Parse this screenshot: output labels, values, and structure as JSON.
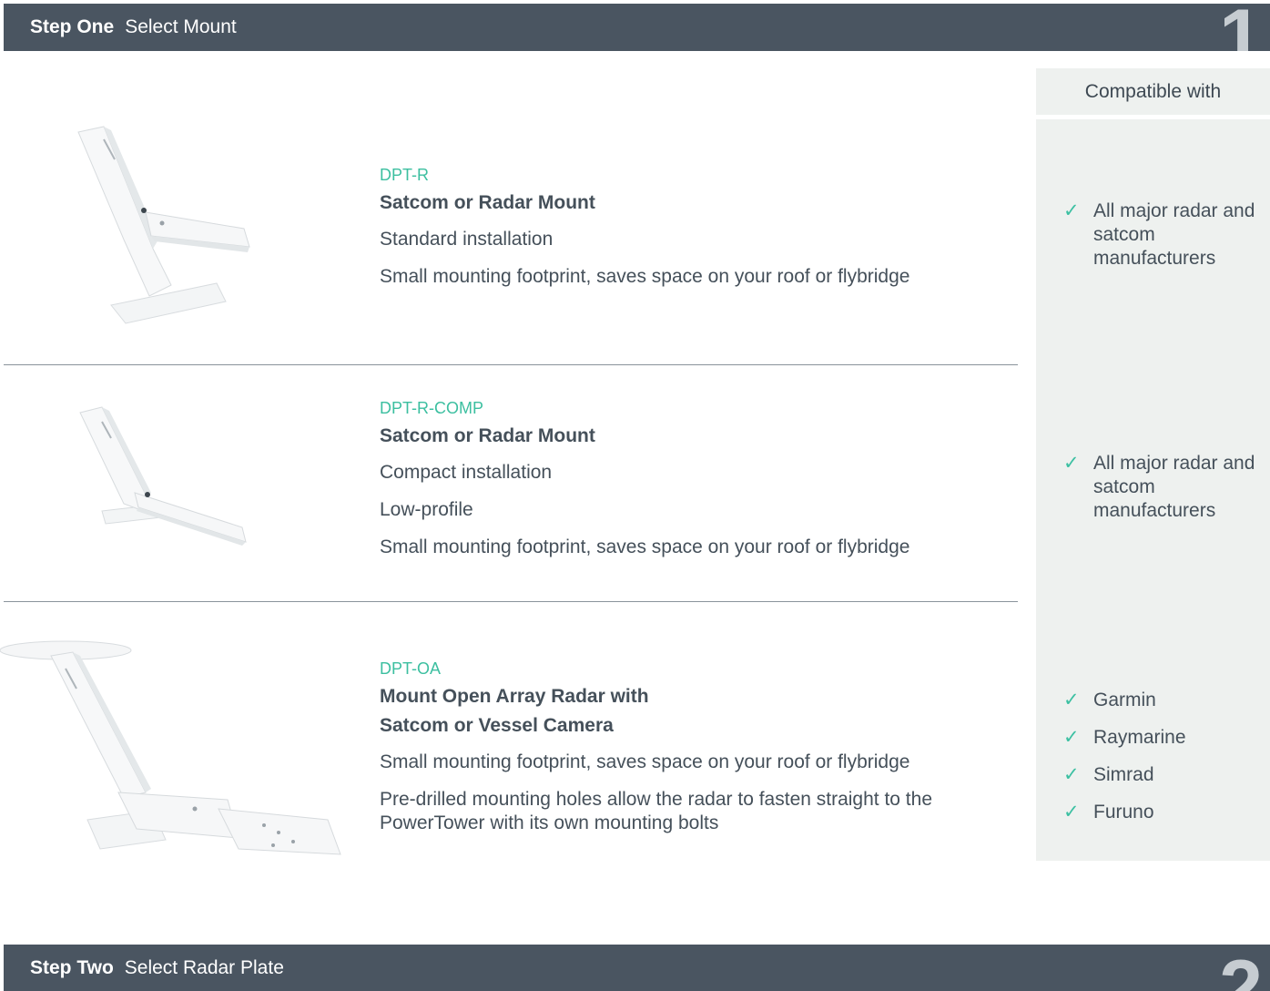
{
  "step1": {
    "label": "Step One",
    "title": "Select Mount",
    "number": "1"
  },
  "step2": {
    "label": "Step Two",
    "title": "Select Radar Plate",
    "number": "2"
  },
  "compat_header": "Compatible with",
  "products": [
    {
      "code": "DPT-R",
      "title": "Satcom or Radar Mount",
      "features": [
        "Standard installation",
        "Small mounting footprint, saves space on your roof or flybridge"
      ],
      "compatible": [
        "All major radar and satcom manufacturers"
      ]
    },
    {
      "code": "DPT-R-COMP",
      "title": "Satcom or Radar Mount",
      "features": [
        "Compact installation",
        "Low-profile",
        "Small mounting footprint, saves space on your roof or flybridge"
      ],
      "compatible": [
        "All major radar and satcom manufacturers"
      ]
    },
    {
      "code": "DPT-OA",
      "title_line1": "Mount Open Array Radar with",
      "title_line2": "Satcom or Vessel Camera",
      "features": [
        "Small mounting footprint, saves space on your roof or flybridge",
        "Pre-drilled mounting holes allow the radar to fasten straight to the PowerTower with its own mounting bolts"
      ],
      "compatible": [
        "Garmin",
        "Raymarine",
        "Simrad",
        "Furuno"
      ]
    }
  ],
  "check_glyph": "✓",
  "colors": {
    "bar": "#4a5561",
    "accent": "#3cbfa0",
    "panel": "#eef1ef"
  }
}
